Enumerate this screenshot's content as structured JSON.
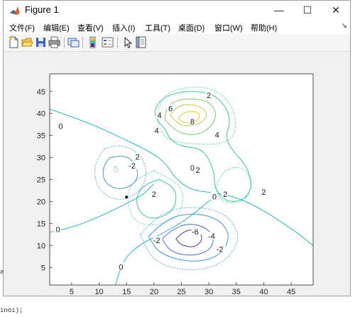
{
  "window": {
    "title": "Figure 1",
    "controls": {
      "minimize": "—",
      "maximize": "☐",
      "close": "✕"
    }
  },
  "menu": {
    "items": [
      {
        "label": "文件(F)"
      },
      {
        "label": "编辑(E)"
      },
      {
        "label": "查看(V)"
      },
      {
        "label": "插入(I)"
      },
      {
        "label": "工具(T)"
      },
      {
        "label": "桌面(D)"
      },
      {
        "label": "窗口(W)"
      },
      {
        "label": "帮助(H)"
      }
    ],
    "overflow": "↘"
  },
  "toolbar": {
    "buttons": [
      "new-figure-icon",
      "open-file-icon",
      "save-icon",
      "print-icon",
      "link-figure-icon",
      "colorbar-icon",
      "legend-icon",
      "pointer-icon",
      "property-editor-icon"
    ]
  },
  "background_text": {
    "left_char": "a",
    "bottom_code": "inoi);"
  },
  "chart_data": {
    "type": "contour",
    "title": "",
    "xlabel": "",
    "ylabel": "",
    "xlim": [
      1,
      49
    ],
    "ylim": [
      1,
      49
    ],
    "xticks": [
      "5",
      "10",
      "15",
      "20",
      "25",
      "30",
      "35",
      "40",
      "45"
    ],
    "yticks": [
      "5",
      "10",
      "15",
      "20",
      "25",
      "30",
      "35",
      "40",
      "45"
    ],
    "grid": false,
    "contour_labels": [
      "0",
      "0",
      "0",
      "0",
      "0",
      "2",
      "2",
      "2",
      "2",
      "2",
      "2",
      "4",
      "4",
      "4",
      "6",
      "8",
      "-2",
      "-2",
      "-2",
      "-4",
      "-6"
    ],
    "marked_point": {
      "x": 15,
      "y": 21
    },
    "level_colors": {
      "-6": "#3b3bb0",
      "-4": "#4f6fd8",
      "-2": "#3f97d4",
      "0": "#26b8c8",
      "2": "#33c8a0",
      "4": "#7ccb6f",
      "6": "#c4c94a",
      "8": "#f0c520"
    }
  }
}
